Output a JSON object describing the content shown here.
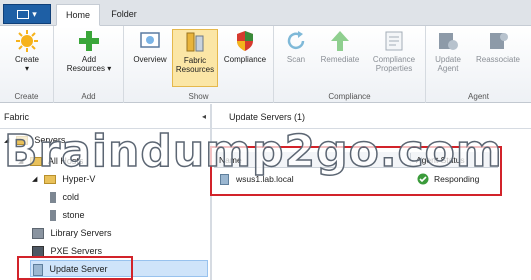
{
  "app_button_label": "▾",
  "tabs": [
    "Home",
    "Folder"
  ],
  "ribbon": {
    "groups": [
      {
        "label": "Create",
        "buttons": [
          {
            "label": "Create\n▾",
            "icon": "create-sun-icon"
          }
        ]
      },
      {
        "label": "Add",
        "buttons": [
          {
            "label": "Add\nResources ▾",
            "icon": "add-plus-icon"
          }
        ]
      },
      {
        "label": "Show",
        "buttons": [
          {
            "label": "Overview",
            "icon": "overview-icon"
          },
          {
            "label": "Fabric\nResources",
            "icon": "fabric-resources-icon"
          },
          {
            "label": "Compliance",
            "icon": "compliance-shield-icon"
          }
        ]
      },
      {
        "label": "Compliance",
        "buttons": [
          {
            "label": "Scan",
            "icon": "scan-icon"
          },
          {
            "label": "Remediate",
            "icon": "remediate-arrow-icon"
          },
          {
            "label": "Compliance\nProperties",
            "icon": "compliance-properties-icon"
          }
        ]
      },
      {
        "label": "Agent",
        "buttons": [
          {
            "label": "Update\nAgent",
            "icon": "update-agent-icon"
          },
          {
            "label": "Reassociate",
            "icon": "reassociate-icon"
          }
        ]
      }
    ]
  },
  "nav": {
    "header": "Fabric",
    "collapse_glyph": "◂",
    "items": [
      {
        "label": "Servers"
      },
      {
        "label": "All Hosts"
      },
      {
        "label": "Hyper-V"
      },
      {
        "label": "cold"
      },
      {
        "label": "stone"
      },
      {
        "label": "Library Servers"
      },
      {
        "label": "PXE Servers"
      },
      {
        "label": "Update Server"
      }
    ]
  },
  "main": {
    "title": "Update Servers (1)",
    "columns": [
      "Name",
      "Agent Status"
    ],
    "rows": [
      {
        "name": "wsus1.lab.local",
        "status": "Responding"
      }
    ]
  },
  "watermark": "Braindump2go.com",
  "colors": {
    "highlight_box": "#d2232a",
    "selection": "#cfe4fa",
    "ribbon_selected": "#fbe6a6",
    "app_button": "#1e5fa5"
  }
}
